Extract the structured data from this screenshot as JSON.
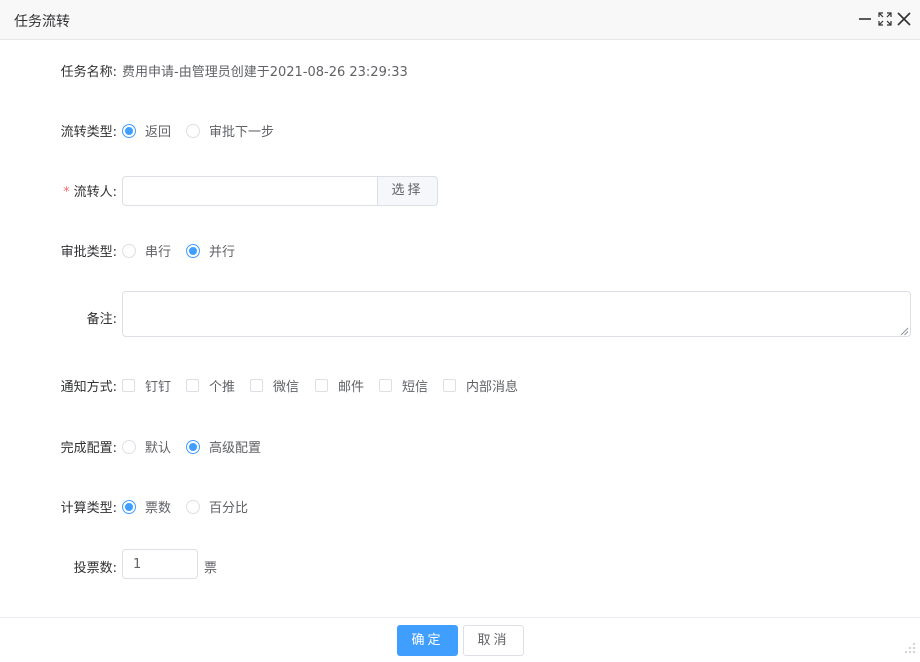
{
  "dialog": {
    "title": "任务流转",
    "controls": {
      "minimize_icon": "minimize-icon",
      "fullscreen_icon": "fullscreen-icon",
      "close_icon": "close-icon"
    }
  },
  "form": {
    "task_name": {
      "label": "任务名称:",
      "value": "费用申请-由管理员创建于2021-08-26 23:29:33"
    },
    "flow_type": {
      "label": "流转类型:",
      "options": [
        "返回",
        "审批下一步"
      ],
      "selected": "返回"
    },
    "assignee": {
      "label": "流转人:",
      "required_mark": "*",
      "value": "",
      "button": "选择"
    },
    "approval_type": {
      "label": "审批类型:",
      "options": [
        "串行",
        "并行"
      ],
      "selected": "并行"
    },
    "remark": {
      "label": "备注:",
      "value": ""
    },
    "notify": {
      "label": "通知方式:",
      "options": [
        "钉钉",
        "个推",
        "微信",
        "邮件",
        "短信",
        "内部消息"
      ],
      "checked": []
    },
    "completion": {
      "label": "完成配置:",
      "options": [
        "默认",
        "高级配置"
      ],
      "selected": "高级配置"
    },
    "calc_type": {
      "label": "计算类型:",
      "options": [
        "票数",
        "百分比"
      ],
      "selected": "票数"
    },
    "votes": {
      "label": "投票数:",
      "value": "1",
      "unit": "票"
    }
  },
  "footer": {
    "confirm": "确定",
    "cancel": "取消"
  },
  "colors": {
    "primary": "#409eff",
    "required": "#f56c6c",
    "border": "#dcdfe6"
  }
}
